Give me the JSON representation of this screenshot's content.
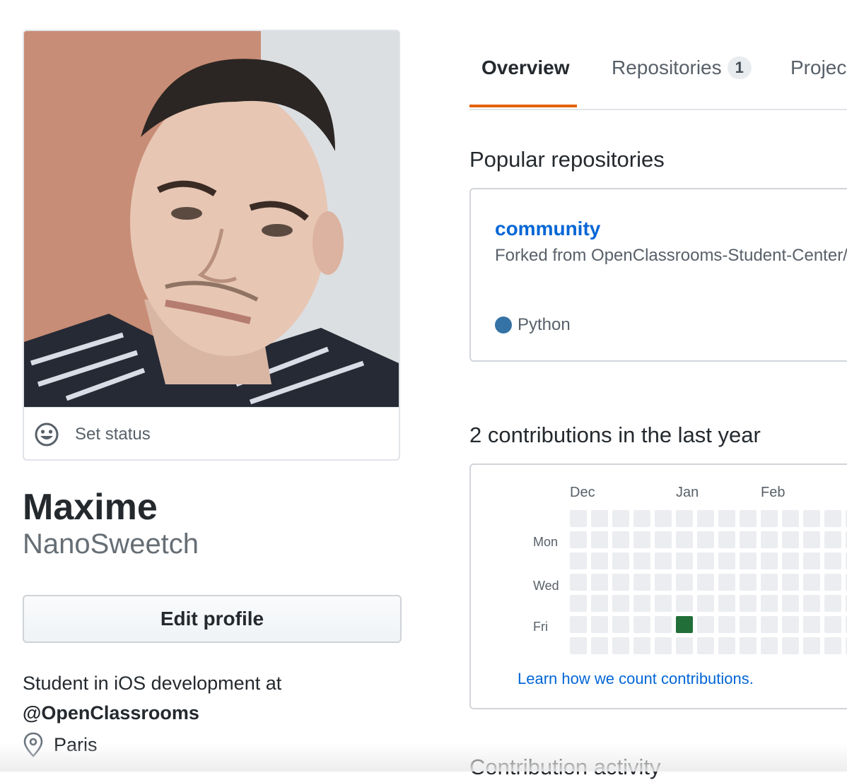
{
  "profile": {
    "set_status_label": "Set status",
    "full_name": "Maxime",
    "username": "NanoSweetch",
    "edit_profile_label": "Edit profile",
    "bio_text": "Student in iOS development at",
    "bio_org": "@OpenClassrooms",
    "location": "Paris"
  },
  "tabs": [
    {
      "label": "Overview",
      "active": true
    },
    {
      "label": "Repositories",
      "count": "1"
    },
    {
      "label": "Projec"
    }
  ],
  "popular": {
    "title": "Popular repositories",
    "repos": [
      {
        "name": "community",
        "forked_from": "Forked from OpenClassrooms-Student-Center/",
        "language": "Python",
        "language_color": "#3572a5"
      }
    ]
  },
  "contributions": {
    "title": "2 contributions in the last year",
    "months": [
      "Dec",
      "Jan",
      "Feb"
    ],
    "days": [
      "Mon",
      "Wed",
      "Fri"
    ],
    "weeks_visible": 14,
    "active_cells": [
      {
        "week": 5,
        "day": 5,
        "level": 4,
        "color": "#216e39"
      }
    ],
    "empty_color": "#ebedf0",
    "learn_link": "Learn how we count contributions."
  },
  "activity": {
    "title": "Contribution activity"
  },
  "colors": {
    "accent": "#e36209",
    "link": "#0366d6"
  }
}
